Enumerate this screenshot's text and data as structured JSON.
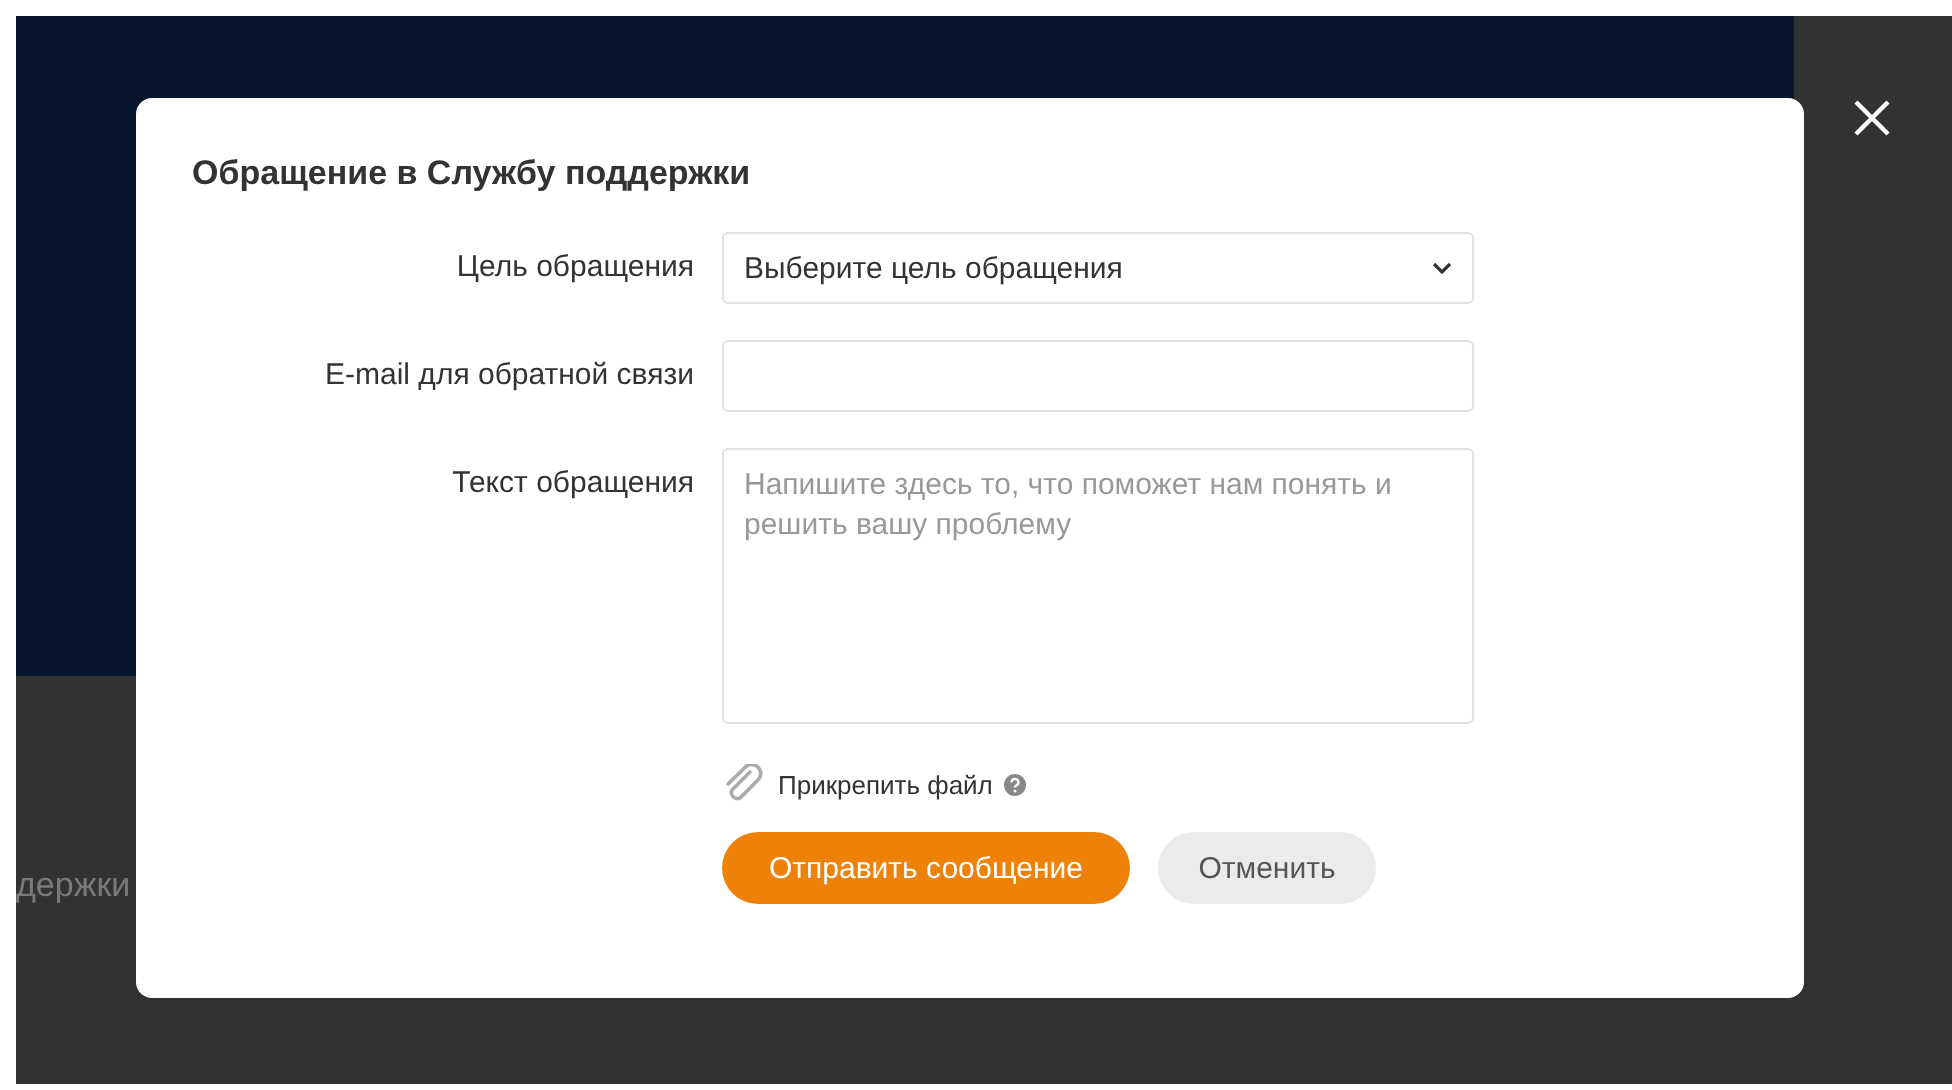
{
  "background_page": {
    "text": "держки"
  },
  "dialog": {
    "title": "Обращение в Службу поддержки",
    "fields": [
      {
        "kind": "select",
        "label": "Цель обращения",
        "value": "Выберите цель обращения"
      },
      {
        "kind": "input",
        "label": "E-mail для обратной связи"
      },
      {
        "kind": "textarea",
        "label": "Текст обращения",
        "placeholder": "Напишите здесь то, что поможет нам понять и решить вашу проблему"
      }
    ],
    "attach": {
      "label": "Прикрепить файл"
    },
    "buttons": [
      {
        "kind": "primary",
        "label": "Отправить сообщение"
      },
      {
        "kind": "secondary",
        "label": "Отменить"
      }
    ]
  }
}
